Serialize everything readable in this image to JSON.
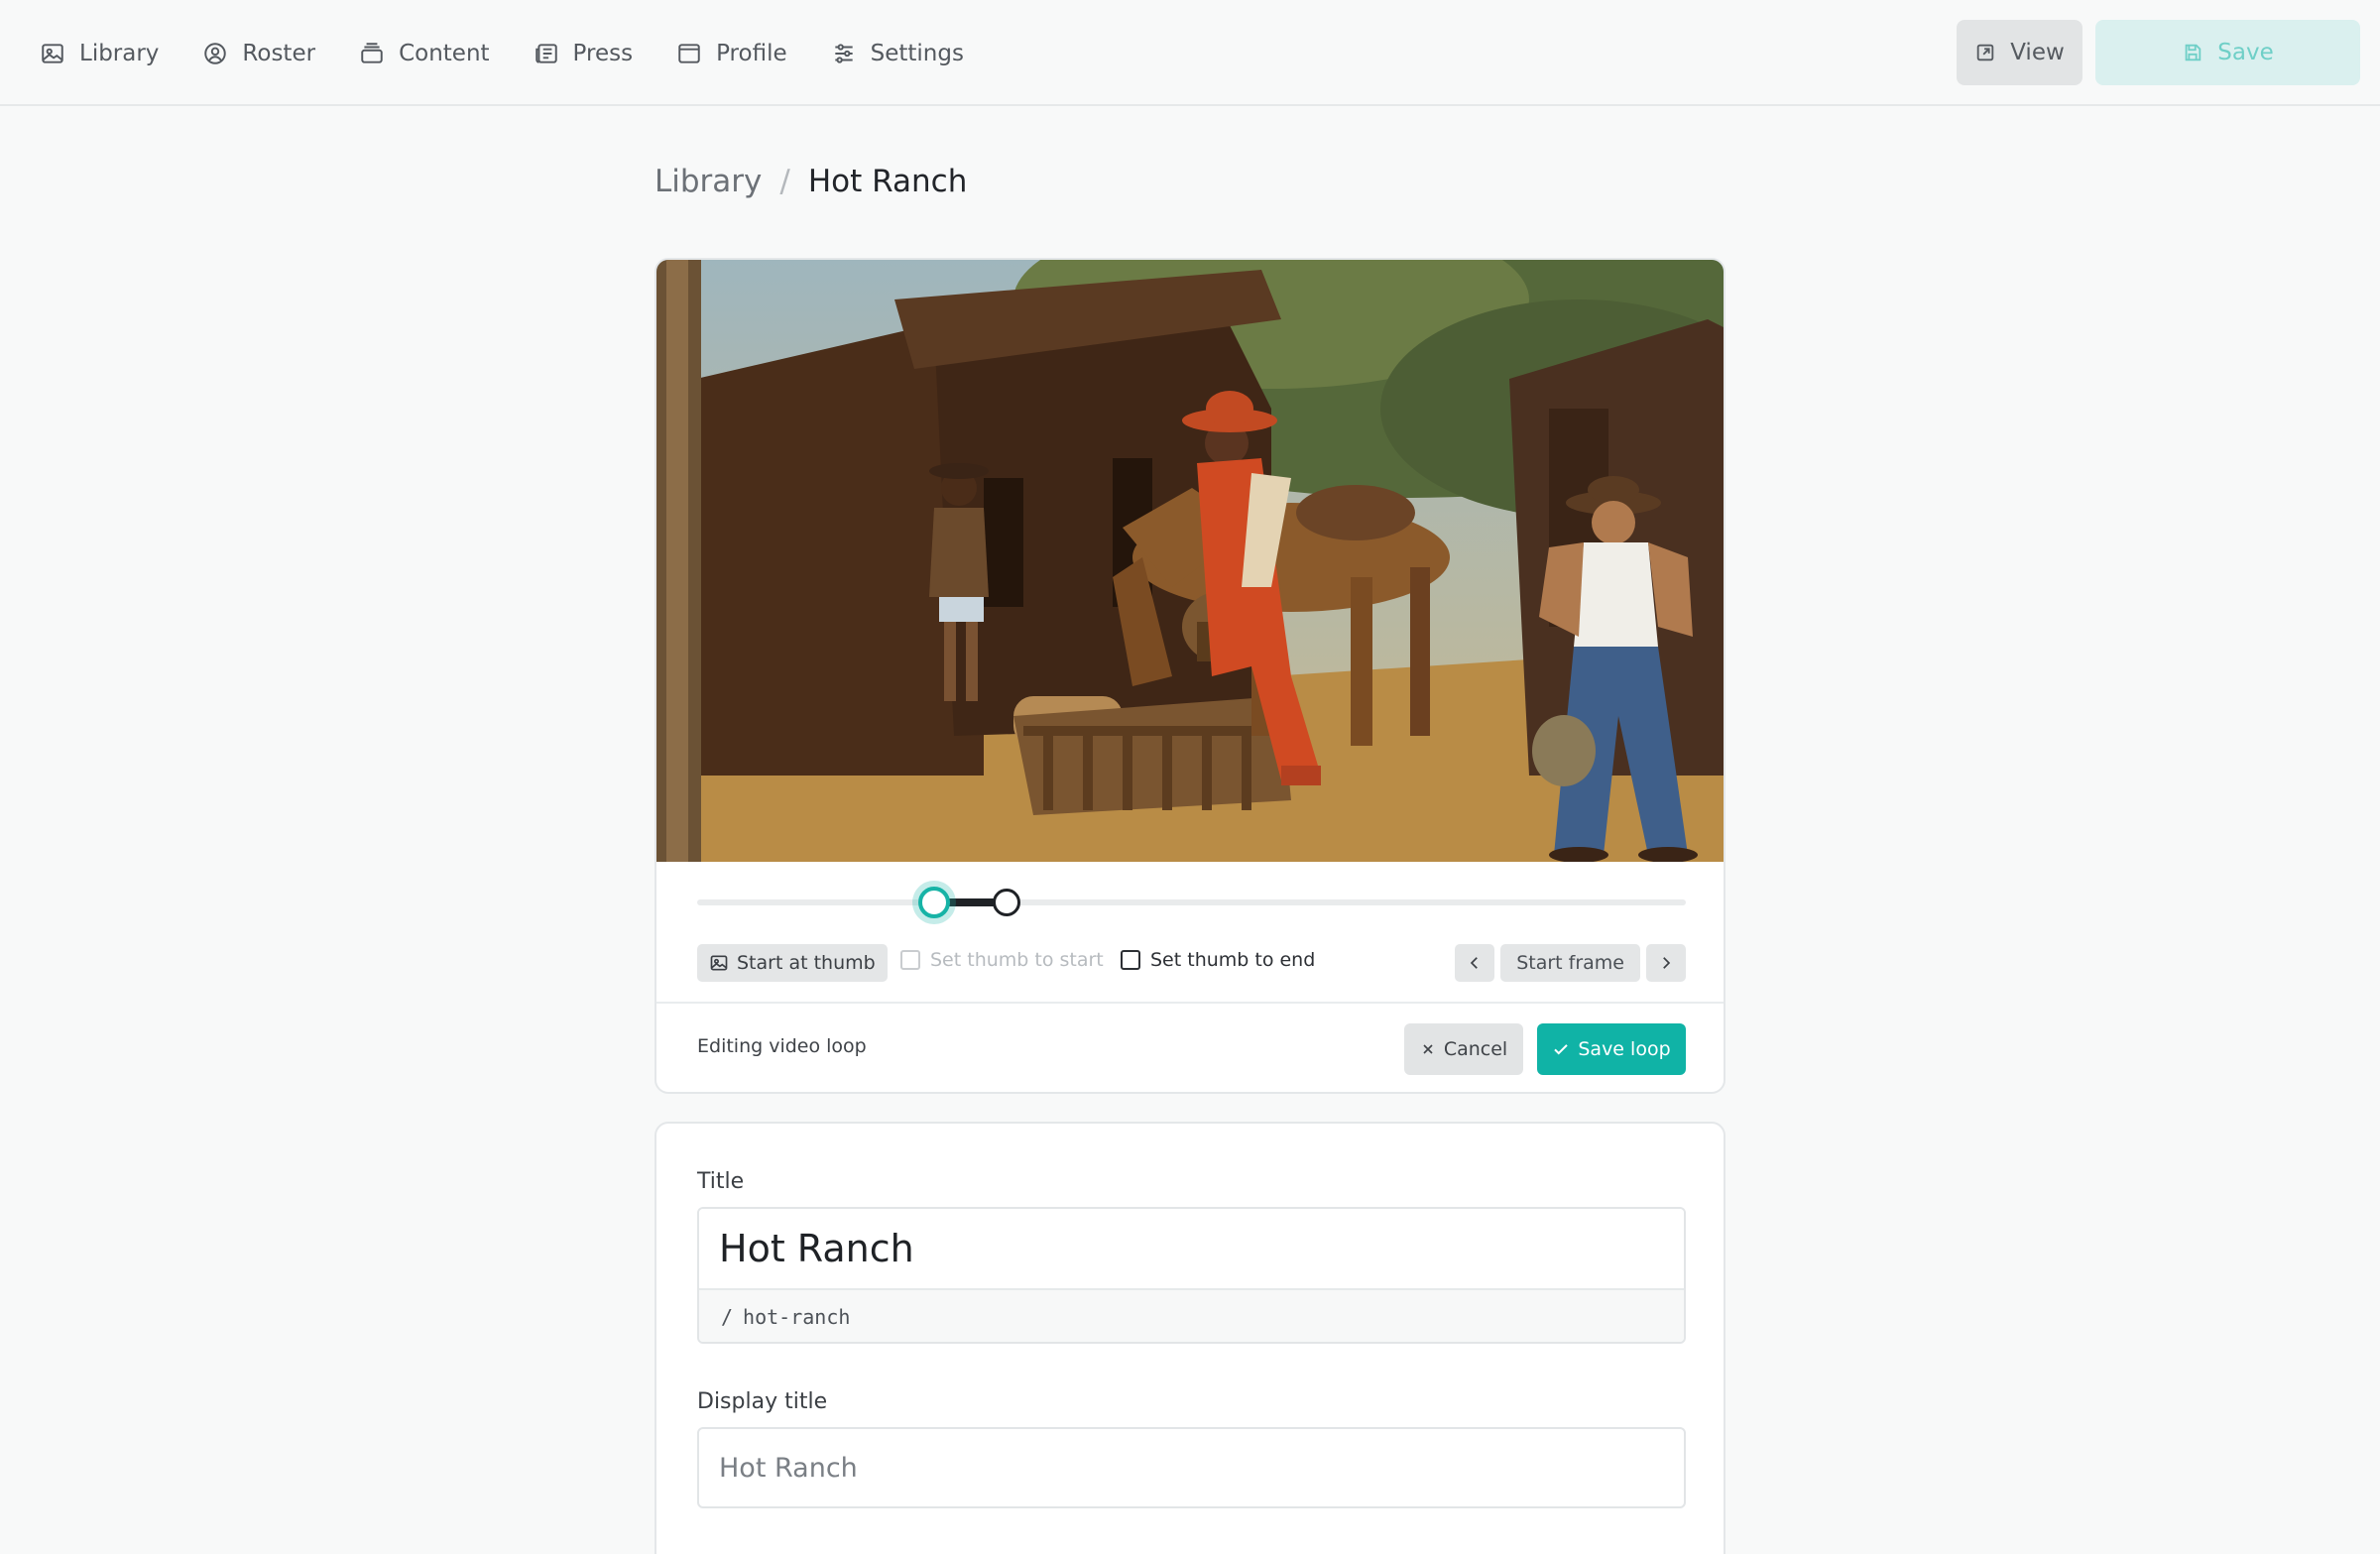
{
  "nav": {
    "items": [
      {
        "label": "Library",
        "icon": "image-icon"
      },
      {
        "label": "Roster",
        "icon": "user-circle-icon"
      },
      {
        "label": "Content",
        "icon": "stack-icon"
      },
      {
        "label": "Press",
        "icon": "newspaper-icon"
      },
      {
        "label": "Profile",
        "icon": "window-icon"
      },
      {
        "label": "Settings",
        "icon": "sliders-icon"
      }
    ],
    "view_label": "View",
    "save_label": "Save"
  },
  "breadcrumb": {
    "parent": "Library",
    "separator": "/",
    "current": "Hot Ranch"
  },
  "video": {
    "scene": "western ranch scene with cowboys and a horse",
    "loop_start_fraction": 0.24,
    "loop_end_fraction": 0.313,
    "controls": {
      "start_at_thumb": "Start at thumb",
      "set_thumb_to_start": "Set thumb to start",
      "set_thumb_to_end": "Set thumb to end",
      "frame_label": "Start frame"
    },
    "status": "Editing video loop",
    "cancel_label": "Cancel",
    "save_loop_label": "Save loop"
  },
  "form": {
    "title_label": "Title",
    "title_value": "Hot Ranch",
    "slug_prefix": "/",
    "slug": "hot-ranch",
    "display_title_label": "Display title",
    "display_title_placeholder": "Hot Ranch"
  },
  "colors": {
    "accent": "#10b3a6",
    "accent_light": "#daf0ef"
  }
}
